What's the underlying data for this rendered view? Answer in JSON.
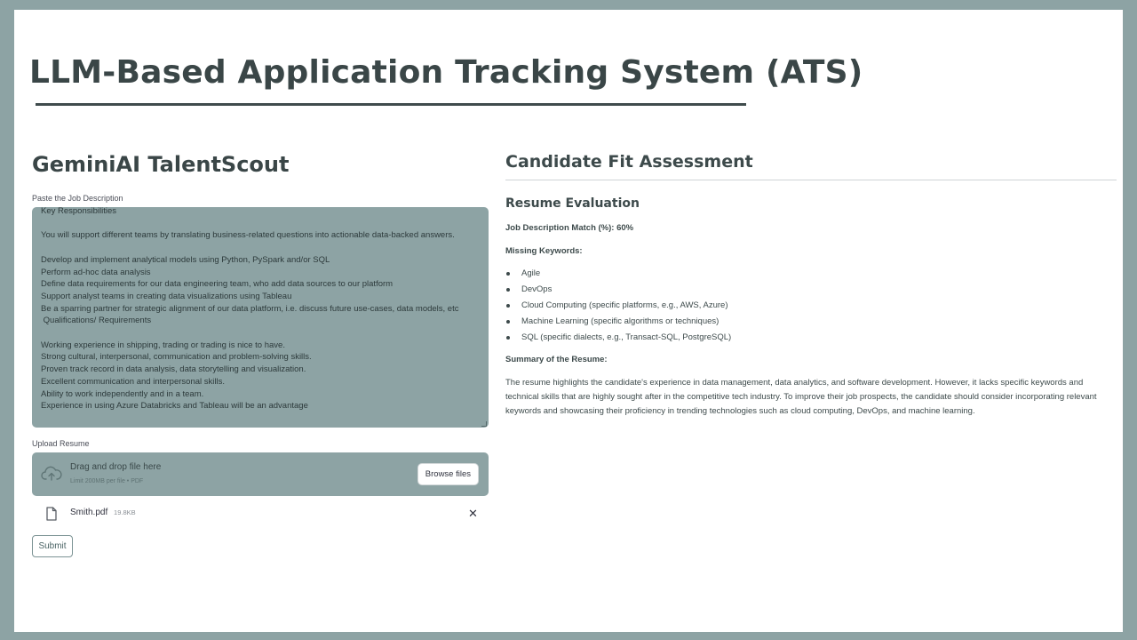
{
  "header": {
    "title": "LLM-Based Application Tracking System (ATS)"
  },
  "app": {
    "title": "GeminiAI TalentScout",
    "jd_label": "Paste the Job Description",
    "jd_text": "Key Responsibilities\n\nYou will support different teams by translating business-related questions into actionable data-backed answers.\n\nDevelop and implement analytical models using Python, PySpark and/or SQL\nPerform ad-hoc data analysis\nDefine data requirements for our data engineering team, who add data sources to our platform\nSupport analyst teams in creating data visualizations using Tableau\nBe a sparring partner for strategic alignment of our data platform, i.e. discuss future use-cases, data models, etc\n Qualifications/ Requirements\n\nWorking experience in shipping, trading or trading is nice to have.\nStrong cultural, interpersonal, communication and problem-solving skills.\nProven track record in data analysis, data storytelling and visualization.\nExcellent communication and interpersonal skills.\nAbility to work independently and in a team.\nExperience in using Azure Databricks and Tableau will be an advantage",
    "upload_label": "Upload Resume",
    "drop_main": "Drag and drop file here",
    "drop_sub": "Limit 200MB per file • PDF",
    "browse_label": "Browse files",
    "file_name": "Smith.pdf",
    "file_size": "19.8KB",
    "remove_glyph": "✕",
    "submit_label": "Submit"
  },
  "assessment": {
    "title": "Candidate Fit Assessment",
    "section_title": "Resume Evaluation",
    "match_line": "Job Description Match (%): 60%",
    "missing_label": "Missing Keywords:",
    "keywords": [
      "Agile",
      "DevOps",
      "Cloud Computing (specific platforms, e.g., AWS, Azure)",
      "Machine Learning (specific algorithms or techniques)",
      "SQL (specific dialects, e.g., Transact-SQL, PostgreSQL)"
    ],
    "summary_label": "Summary of the Resume:",
    "summary_text": "The resume highlights the candidate's experience in data management, data analytics, and software development. However, it lacks specific keywords and technical skills that are highly sought after in the competitive tech industry. To improve their job prospects, the candidate should consider incorporating relevant keywords and showcasing their proficiency in trending technologies such as cloud computing, DevOps, and machine learning."
  },
  "colors": {
    "frame": "#8da3a4",
    "panel": "#ffffff",
    "input_bg": "#8da3a4",
    "heading": "#3a4647"
  },
  "icons": {
    "upload": "cloud-upload-icon",
    "file": "file-icon",
    "remove": "close-icon"
  }
}
